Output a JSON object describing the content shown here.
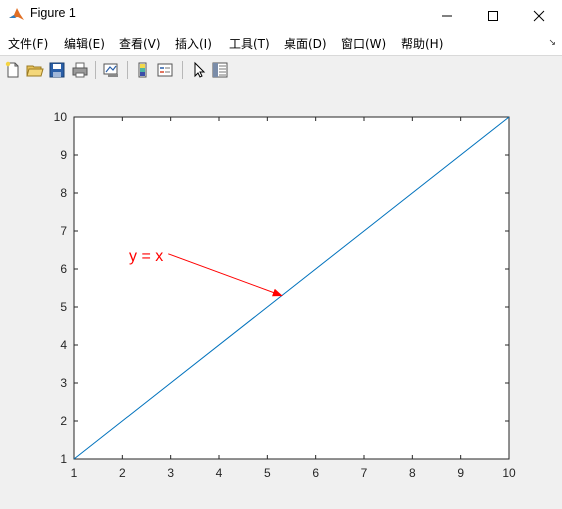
{
  "window": {
    "title": "Figure 1"
  },
  "menu": {
    "items": [
      "文件(F)",
      "编辑(E)",
      "查看(V)",
      "插入(I)",
      "工具(T)",
      "桌面(D)",
      "窗口(W)",
      "帮助(H)"
    ],
    "overflow_icon": "arrow-icon"
  },
  "toolbar": {
    "buttons": [
      "new-figure-icon",
      "open-file-icon",
      "save-icon",
      "print-icon",
      "link-plot-icon",
      "insert-colorbar-icon",
      "insert-legend-icon",
      "edit-plot-icon",
      "property-inspector-icon"
    ]
  },
  "chart_data": {
    "type": "line",
    "series": [
      {
        "x": [
          1,
          10
        ],
        "y": [
          1,
          10
        ],
        "color": "#0072bd"
      }
    ],
    "xlim": [
      1,
      10
    ],
    "ylim": [
      1,
      10
    ],
    "xticks": [
      "1",
      "2",
      "3",
      "4",
      "5",
      "6",
      "7",
      "8",
      "9",
      "10"
    ],
    "yticks": [
      "1",
      "2",
      "3",
      "4",
      "5",
      "6",
      "7",
      "8",
      "9",
      "10"
    ],
    "grid": false,
    "annotation": {
      "text": "y = x",
      "color": "#ff0000",
      "arrow_from": [
        2.95,
        6.4
      ],
      "arrow_to": [
        5.3,
        5.3
      ]
    }
  }
}
